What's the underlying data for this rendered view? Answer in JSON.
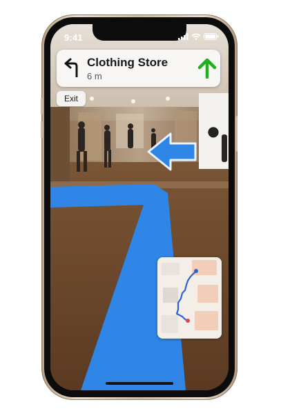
{
  "status_bar": {
    "time": "9:41",
    "icons": [
      "cellular-signal-icon",
      "wifi-icon",
      "battery-icon"
    ]
  },
  "navigation": {
    "turn_icon": "turn-left-arrow-icon",
    "destination": "Clothing Store",
    "distance": "6 m",
    "next_icon": "straight-ahead-arrow-icon",
    "next_icon_color": "#1fb01f"
  },
  "controls": {
    "exit_label": "Exit"
  },
  "ar_overlay": {
    "direction_arrow": "left-arrow-icon",
    "path_color": "#2f86e6",
    "arrow_color": "#2f86e6"
  },
  "mini_map": {
    "route_color": "#2b62d9",
    "destination_pin_color": "#e0453a"
  }
}
